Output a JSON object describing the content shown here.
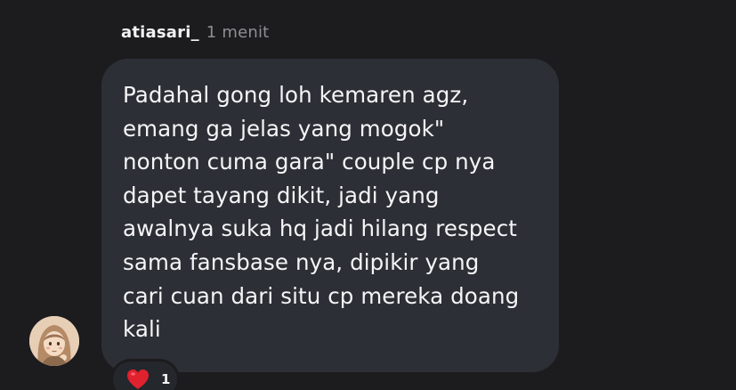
{
  "comment": {
    "username": "atiasari_",
    "timestamp": "1 menit",
    "message_lines": [
      "Padahal gong loh kemaren agz,",
      "emang ga jelas yang mogok\"",
      "nonton cuma gara\" couple cp nya",
      "dapet tayang dikit, jadi yang",
      "awalnya suka hq jadi hilang respect",
      "sama fansbase nya, dipikir yang",
      "cari cuan dari situ cp mereka doang",
      "kali"
    ],
    "reaction": {
      "icon": "heart-icon",
      "count": "1",
      "color": "#e0212e"
    }
  },
  "colors": {
    "background": "#1c1c1e",
    "bubble": "#2c2f35",
    "text": "#f5f5f7",
    "muted": "#8e8e93"
  }
}
